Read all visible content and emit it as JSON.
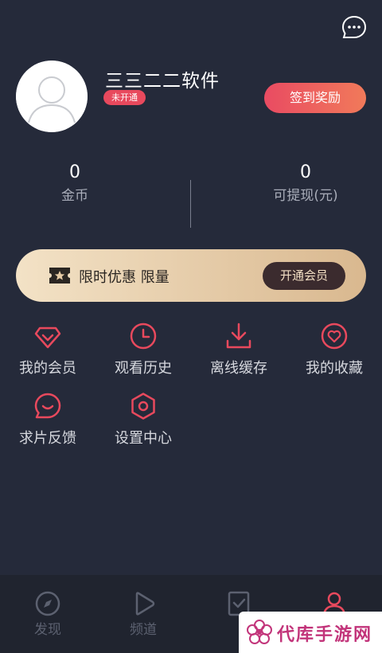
{
  "profile": {
    "username": "三三二二软件",
    "vip_badge": "未开通",
    "sign_button": "签到奖励"
  },
  "stats": [
    {
      "value": "0",
      "label": "金币"
    },
    {
      "value": "0",
      "label": "可提现(元)"
    }
  ],
  "promo": {
    "text": "限时优惠 限量",
    "button": "开通会员"
  },
  "grid": [
    {
      "label": "我的会员",
      "icon": "diamond-icon"
    },
    {
      "label": "观看历史",
      "icon": "clock-icon"
    },
    {
      "label": "离线缓存",
      "icon": "download-icon"
    },
    {
      "label": "我的收藏",
      "icon": "heart-icon"
    },
    {
      "label": "求片反馈",
      "icon": "chat-bubble-icon"
    },
    {
      "label": "设置中心",
      "icon": "settings-hexagon-icon"
    }
  ],
  "tabs": [
    {
      "label": "发现",
      "icon": "compass-icon"
    },
    {
      "label": "频道",
      "icon": "play-icon"
    },
    {
      "label": "",
      "icon": "checklist-icon"
    },
    {
      "label": "",
      "icon": "user-icon"
    }
  ],
  "watermark": {
    "text": "代库手游网"
  },
  "colors": {
    "background": "#252a3a",
    "accent": "#e8495d",
    "promo_gold": "#e6cba5",
    "tab_active": "#e8495d",
    "tab_inactive": "#5c6170"
  }
}
